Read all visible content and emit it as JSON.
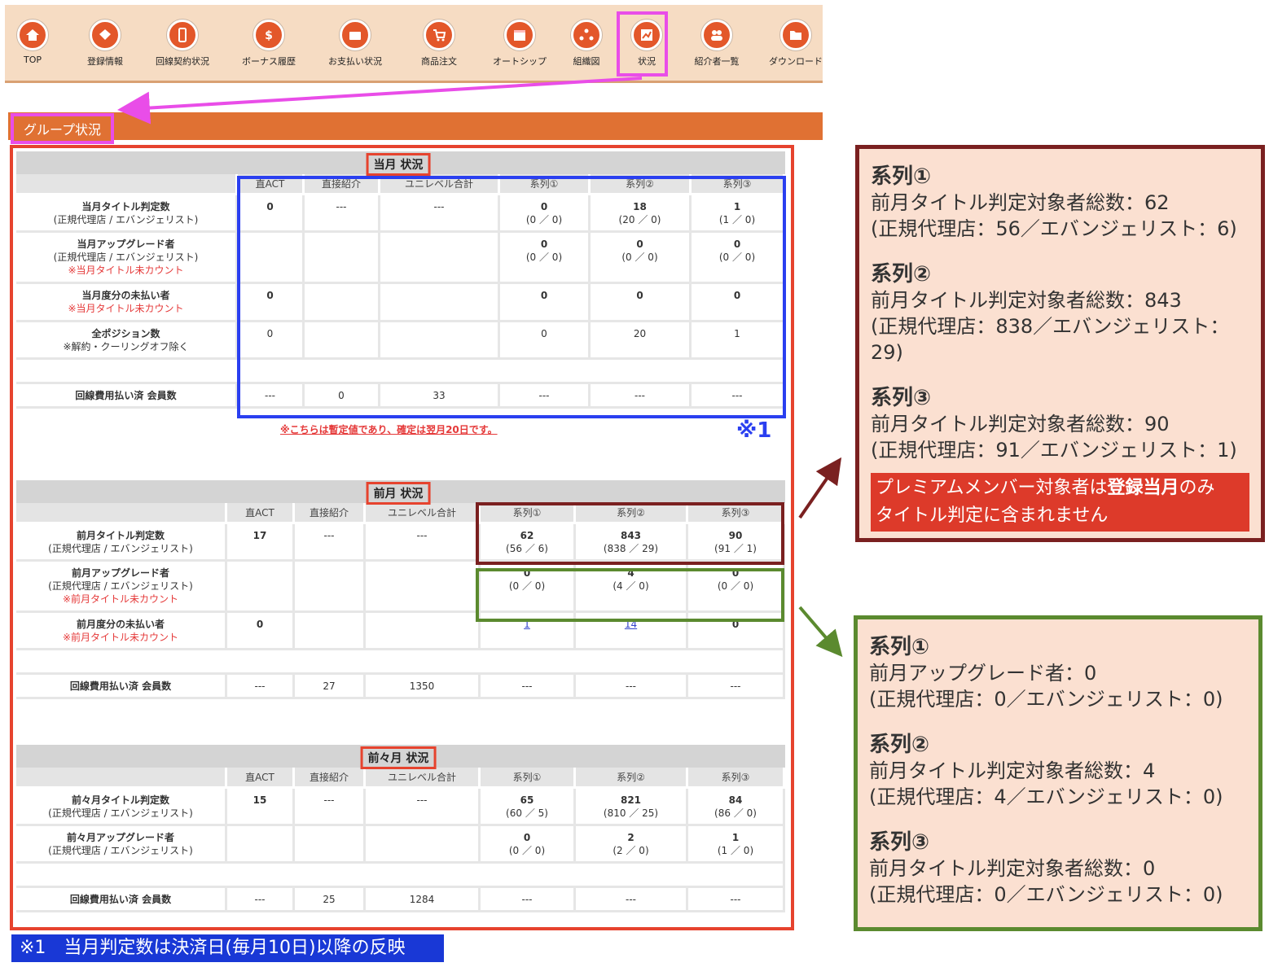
{
  "nav": {
    "items": [
      {
        "label": "TOP",
        "icon": "home-icon"
      },
      {
        "label": "登録情報",
        "icon": "tag-icon"
      },
      {
        "label": "回線契約状況",
        "icon": "phone-icon"
      },
      {
        "label": "ボーナス履歴",
        "icon": "dollar-icon"
      },
      {
        "label": "お支払い状況",
        "icon": "wallet-icon"
      },
      {
        "label": "商品注文",
        "icon": "cart-icon"
      },
      {
        "label": "オートシップ",
        "icon": "calendar-icon"
      },
      {
        "label": "組織図",
        "icon": "org-chart-icon"
      },
      {
        "label": "状況",
        "icon": "chart-icon"
      },
      {
        "label": "紹介者一覧",
        "icon": "users-icon"
      },
      {
        "label": "ダウンロード",
        "icon": "folder-icon"
      }
    ]
  },
  "group_title": "グループ状況",
  "columns": [
    "直ACT",
    "直接紹介",
    "ユニレベル合計",
    "系列①",
    "系列②",
    "系列③"
  ],
  "current": {
    "title": "当月 状況",
    "rows": [
      {
        "label": "当月タイトル判定数",
        "sub": "(正規代理店 / エバンジェリスト)",
        "note": "",
        "cells": [
          {
            "v": "0",
            "s": "",
            "b": true
          },
          {
            "v": "---",
            "s": ""
          },
          {
            "v": "---",
            "s": ""
          },
          {
            "v": "0",
            "s": "(0 ／ 0)",
            "b": true
          },
          {
            "v": "18",
            "s": "(20 ／ 0)",
            "b": true
          },
          {
            "v": "1",
            "s": "(1 ／ 0)",
            "b": true
          }
        ]
      },
      {
        "label": "当月アップグレード者",
        "sub": "(正規代理店 / エバンジェリスト)",
        "note": "※当月タイトル未カウント",
        "cells": [
          {
            "v": "",
            "s": ""
          },
          {
            "v": "",
            "s": ""
          },
          {
            "v": "",
            "s": ""
          },
          {
            "v": "0",
            "s": "(0 ／ 0)",
            "b": true
          },
          {
            "v": "0",
            "s": "(0 ／ 0)",
            "b": true
          },
          {
            "v": "0",
            "s": "(0 ／ 0)",
            "b": true
          }
        ]
      },
      {
        "label": "当月度分の未払い者",
        "sub": "",
        "note": "※当月タイトル未カウント",
        "cells": [
          {
            "v": "0",
            "s": "",
            "b": true
          },
          {
            "v": "",
            "s": ""
          },
          {
            "v": "",
            "s": ""
          },
          {
            "v": "0",
            "s": "",
            "b": true
          },
          {
            "v": "0",
            "s": "",
            "b": true
          },
          {
            "v": "0",
            "s": "",
            "b": true
          }
        ]
      },
      {
        "label": "全ポジション数",
        "sub": "※解約・クーリングオフ除く",
        "note": "",
        "cells": [
          {
            "v": "0",
            "s": ""
          },
          {
            "v": "",
            "s": ""
          },
          {
            "v": "",
            "s": ""
          },
          {
            "v": "0",
            "s": ""
          },
          {
            "v": "20",
            "s": ""
          },
          {
            "v": "1",
            "s": ""
          }
        ]
      }
    ],
    "paid": {
      "label": "回線費用払い済 会員数",
      "cells": [
        "---",
        "0",
        "33",
        "---",
        "---",
        "---"
      ]
    },
    "note": "※こちらは暫定値であり、確定は翌月20日です。",
    "mark": "※1"
  },
  "previous": {
    "title": "前月 状況",
    "rows": [
      {
        "label": "前月タイトル判定数",
        "sub": "(正規代理店 / エバンジェリスト)",
        "note": "",
        "cells": [
          {
            "v": "17",
            "s": "",
            "b": true
          },
          {
            "v": "---",
            "s": ""
          },
          {
            "v": "---",
            "s": ""
          },
          {
            "v": "62",
            "s": "(56 ／ 6)",
            "b": true
          },
          {
            "v": "843",
            "s": "(838 ／ 29)",
            "b": true
          },
          {
            "v": "90",
            "s": "(91 ／ 1)",
            "b": true
          }
        ]
      },
      {
        "label": "前月アップグレード者",
        "sub": "(正規代理店 / エバンジェリスト)",
        "note": "※前月タイトル未カウント",
        "cells": [
          {
            "v": "",
            "s": ""
          },
          {
            "v": "",
            "s": ""
          },
          {
            "v": "",
            "s": ""
          },
          {
            "v": "0",
            "s": "(0 ／ 0)",
            "b": true
          },
          {
            "v": "4",
            "s": "(4 ／ 0)",
            "b": true
          },
          {
            "v": "0",
            "s": "(0 ／ 0)",
            "b": true
          }
        ]
      },
      {
        "label": "前月度分の未払い者",
        "sub": "",
        "note": "※前月タイトル未カウント",
        "cells": [
          {
            "v": "0",
            "s": "",
            "b": true
          },
          {
            "v": "",
            "s": ""
          },
          {
            "v": "",
            "s": ""
          },
          {
            "v": "1",
            "s": "",
            "link": true
          },
          {
            "v": "14",
            "s": "",
            "link": true
          },
          {
            "v": "0",
            "s": "",
            "b": true
          }
        ]
      }
    ],
    "paid": {
      "label": "回線費用払い済 会員数",
      "cells": [
        "---",
        "27",
        "1350",
        "---",
        "---",
        "---"
      ]
    }
  },
  "before_previous": {
    "title": "前々月 状況",
    "rows": [
      {
        "label": "前々月タイトル判定数",
        "sub": "(正規代理店 / エバンジェリスト)",
        "note": "",
        "cells": [
          {
            "v": "15",
            "s": "",
            "b": true
          },
          {
            "v": "---",
            "s": ""
          },
          {
            "v": "---",
            "s": ""
          },
          {
            "v": "65",
            "s": "(60 ／ 5)",
            "b": true
          },
          {
            "v": "821",
            "s": "(810 ／ 25)",
            "b": true
          },
          {
            "v": "84",
            "s": "(86 ／ 0)",
            "b": true
          }
        ]
      },
      {
        "label": "前々月アップグレード者",
        "sub": "(正規代理店 / エバンジェリスト)",
        "note": "",
        "cells": [
          {
            "v": "",
            "s": ""
          },
          {
            "v": "",
            "s": ""
          },
          {
            "v": "",
            "s": ""
          },
          {
            "v": "0",
            "s": "(0 ／ 0)",
            "b": true
          },
          {
            "v": "2",
            "s": "(2 ／ 0)",
            "b": true
          },
          {
            "v": "1",
            "s": "(1 ／ 0)",
            "b": true
          }
        ]
      }
    ],
    "paid": {
      "label": "回線費用払い済 会員数",
      "cells": [
        "---",
        "25",
        "1284",
        "---",
        "---",
        "---"
      ]
    }
  },
  "callout1": {
    "blocks": [
      {
        "h": "系列①",
        "l1": "前月タイトル判定対象者総数：62",
        "l2": "(正規代理店：56／エバンジェリスト：6)"
      },
      {
        "h": "系列②",
        "l1": "前月タイトル判定対象者総数：843",
        "l2": "(正規代理店：838／エバンジェリスト：29)"
      },
      {
        "h": "系列③",
        "l1": "前月タイトル判定対象者総数：90",
        "l2": "(正規代理店：91／エバンジェリスト：1)"
      }
    ],
    "premium_a": "プレミアムメンバー対象者は",
    "premium_b": "登録当月",
    "premium_c": "のみ",
    "premium_d": "タイトル判定に含まれません"
  },
  "callout2": {
    "blocks": [
      {
        "h": "系列①",
        "l1": "前月アップグレード者：0",
        "l2": "(正規代理店：0／エバンジェリスト：0)"
      },
      {
        "h": "系列②",
        "l1": "前月タイトル判定対象者総数：4",
        "l2": "(正規代理店：4／エバンジェリスト：0)"
      },
      {
        "h": "系列③",
        "l1": "前月タイトル判定対象者総数：0",
        "l2": "(正規代理店：0／エバンジェリスト：0)"
      }
    ]
  },
  "footnote": "※1　当月判定数は決済日(毎月10日)以降の反映",
  "colors": {
    "accent": "#e07133",
    "red_frame": "#e6432e",
    "blue_frame": "#2a3ff0",
    "dark_red": "#7a2020",
    "green": "#5b8a2f",
    "magenta": "#e94de8"
  }
}
